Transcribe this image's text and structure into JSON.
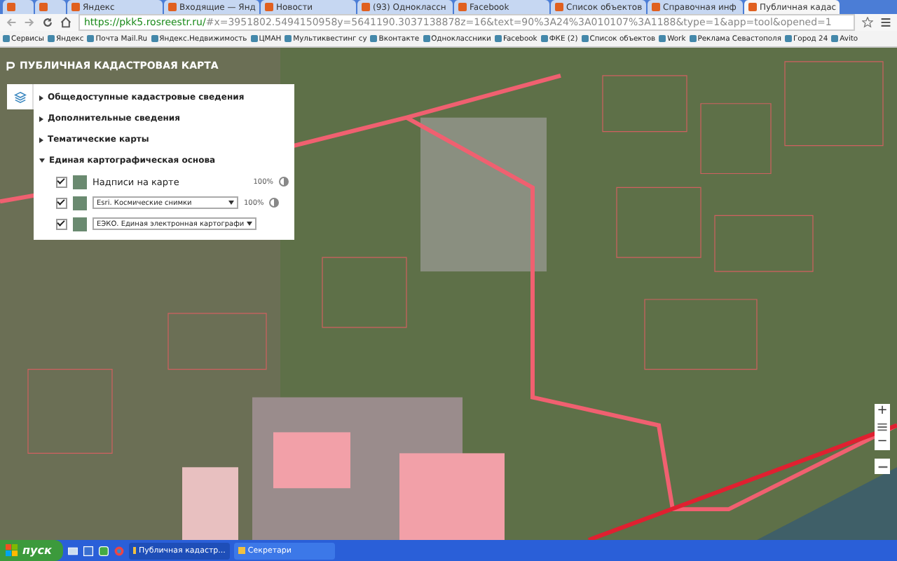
{
  "browser": {
    "tabs": [
      {
        "selected": false
      },
      {
        "selected": false
      },
      {
        "title": "Яндекс",
        "selected": false
      },
      {
        "title": "Входящие — Янд",
        "selected": false
      },
      {
        "title": "Новости",
        "selected": false
      },
      {
        "title": "(93) Одноклассн",
        "selected": false
      },
      {
        "title": "Facebook",
        "selected": false
      },
      {
        "title": "Список объектов",
        "selected": false
      },
      {
        "title": "Справочная инф",
        "selected": false
      },
      {
        "title": "Публичная кадас",
        "selected": true
      }
    ],
    "url": {
      "host": "https://pkk5.rosreestr.ru/",
      "rest": "#x=3951802.5494150958y=5641190.3037138878z=16&text=90%3A24%3A010107%3A1188&type=1&app=tool&opened=1"
    },
    "bookmarks": [
      "Сервисы",
      "Яндекс",
      "Почта Mail.Ru",
      "Яндекс.Недвижимость",
      "ЦМАН",
      "Мультиквестинг су",
      "Вконтакте",
      "Одноклассники",
      "Facebook",
      "ФКЕ (2)",
      "Список объектов",
      "Work",
      "Реклама Севастополя",
      "Город 24",
      "Avito"
    ]
  },
  "page": {
    "title": "ПУБЛИЧНАЯ КАДАСТРОВАЯ КАРТА",
    "layer_panel": {
      "sections": [
        {
          "label": "Общедоступные кадастровые сведения",
          "expanded": false
        },
        {
          "label": "Дополнительные сведения",
          "expanded": false
        },
        {
          "label": "Тематические карты",
          "expanded": false
        },
        {
          "label": "Единая картографическая основа",
          "expanded": true
        }
      ],
      "layers": [
        {
          "kind": "label",
          "label": "Надписи на карте",
          "checked": true,
          "opacity": "100%"
        },
        {
          "kind": "select",
          "label": "Esri. Космические снимки",
          "checked": true,
          "opacity": "100%"
        },
        {
          "kind": "select",
          "label": "ЕЭКО. Единая электронная картографи",
          "checked": true
        }
      ]
    },
    "zoom_controls": {
      "zoom_in": "+",
      "zoom_out": "−"
    }
  },
  "taskbar": {
    "start": "пуск",
    "windows": [
      {
        "title": "Публичная кадастр...",
        "selected": true
      },
      {
        "title": "Секретари",
        "selected": false
      }
    ]
  }
}
